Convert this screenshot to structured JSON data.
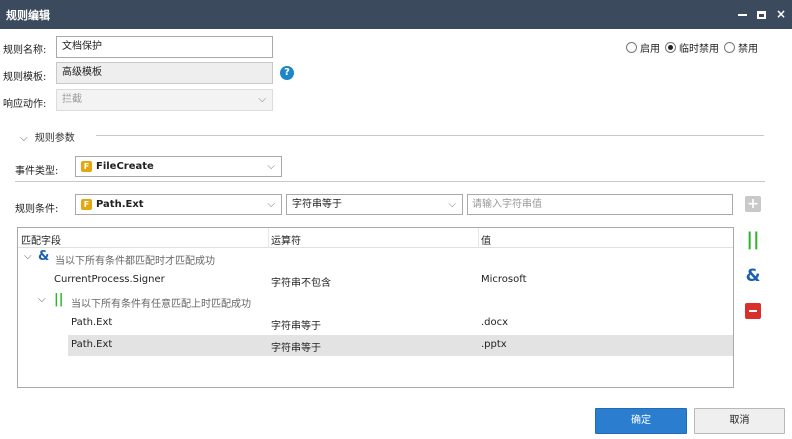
{
  "window": {
    "title": "规则编辑",
    "min_label": "",
    "max_label": "",
    "close_label": "×"
  },
  "form": {
    "name_label": "规则名称:",
    "name_value": "文档保护",
    "template_label": "规则模板:",
    "template_value": "高级模板",
    "help_glyph": "?",
    "action_label": "响应动作:",
    "action_value": "拦截"
  },
  "status": {
    "options": [
      {
        "label": "启用",
        "selected": false
      },
      {
        "label": "临时禁用",
        "selected": true
      },
      {
        "label": "禁用",
        "selected": false
      }
    ]
  },
  "params": {
    "section_label": "规则参数",
    "event_type_label": "事件类型:",
    "event_type_icon": "F",
    "event_type_value": "FileCreate"
  },
  "condition": {
    "label": "规则条件:",
    "field_icon": "F",
    "field_value": "Path.Ext",
    "operator_value": "字符串等于",
    "value_placeholder": "请输入字符串值"
  },
  "table": {
    "headers": [
      "匹配字段",
      "运算符",
      "值"
    ],
    "rows": [
      {
        "type": "group",
        "logic": "and",
        "text": "当以下所有条件都匹配时才匹配成功"
      },
      {
        "type": "leaf",
        "field": "CurrentProcess.Signer",
        "op": "字符串不包含",
        "value": "Microsoft"
      },
      {
        "type": "group",
        "logic": "or",
        "text": "当以下所有条件有任意匹配上时匹配成功"
      },
      {
        "type": "leaf",
        "field": "Path.Ext",
        "op": "字符串等于",
        "value": ".docx"
      },
      {
        "type": "leaf",
        "field": "Path.Ext",
        "op": "字符串等于",
        "value": ".pptx",
        "selected": true
      }
    ]
  },
  "side_buttons": {
    "plus": "+",
    "or": "||",
    "and": "&"
  },
  "footer": {
    "ok_label": "确定",
    "cancel_label": "取消"
  },
  "colors": {
    "titlebar": "#3c4a5e",
    "primary": "#2a7dcf",
    "or_green": "#2bb52b",
    "and_blue": "#1a5fb4",
    "delete_red": "#d9302c",
    "event_icon": "#e3a80f"
  },
  "icons": {
    "chevron": "chevron-down-icon",
    "help": "help-icon",
    "file_event": "file-event-icon"
  }
}
